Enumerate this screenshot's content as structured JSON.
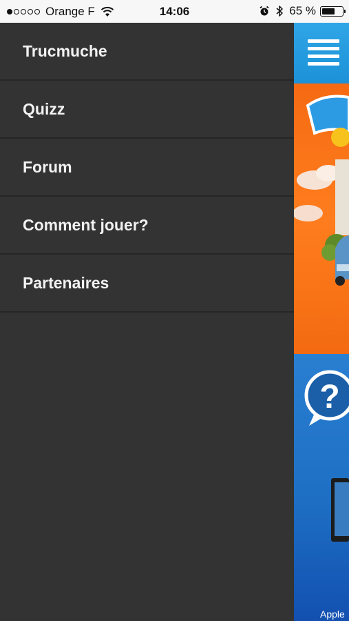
{
  "status_bar": {
    "carrier": "Orange F",
    "signal_strength": 1,
    "time": "14:06",
    "battery_percent": "65 %",
    "battery_level": 0.65,
    "icons": [
      "wifi-icon",
      "alarm-icon",
      "bluetooth-icon",
      "battery-icon"
    ]
  },
  "side_menu": {
    "items": [
      {
        "label": "Trucmuche"
      },
      {
        "label": "Quizz"
      },
      {
        "label": "Forum"
      },
      {
        "label": "Comment jouer?"
      },
      {
        "label": "Partenaires"
      }
    ]
  },
  "main_peek": {
    "menu_icon": "hamburger-icon",
    "footer_text": "Apple"
  },
  "colors": {
    "menu_background": "#333333",
    "menu_separator": "#262626",
    "menu_text": "#f2f2f2",
    "header_blue": "#1c91d8",
    "banner_orange": "#f56a12"
  }
}
